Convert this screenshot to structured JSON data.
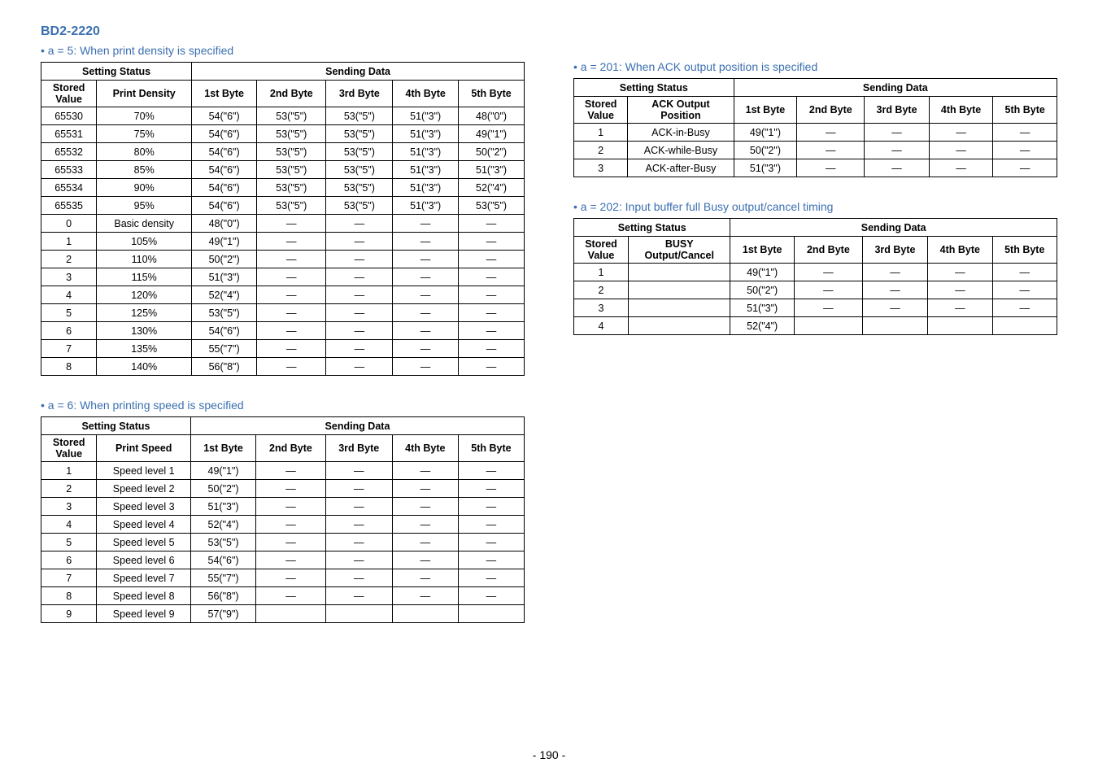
{
  "model": "BD2-2220",
  "page_number": "- 190 -",
  "tables": {
    "t5": {
      "title": "• a = 5: When print density is specified",
      "header_group1": "Setting Status",
      "header_group2": "Sending Data",
      "cols": [
        "Stored Value",
        "Print Density",
        "1st Byte",
        "2nd Byte",
        "3rd Byte",
        "4th Byte",
        "5th Byte"
      ],
      "rows": [
        [
          "65530",
          "70%",
          "54(\"6\")",
          "53(\"5\")",
          "53(\"5\")",
          "51(\"3\")",
          "48(\"0\")"
        ],
        [
          "65531",
          "75%",
          "54(\"6\")",
          "53(\"5\")",
          "53(\"5\")",
          "51(\"3\")",
          "49(\"1\")"
        ],
        [
          "65532",
          "80%",
          "54(\"6\")",
          "53(\"5\")",
          "53(\"5\")",
          "51(\"3\")",
          "50(\"2\")"
        ],
        [
          "65533",
          "85%",
          "54(\"6\")",
          "53(\"5\")",
          "53(\"5\")",
          "51(\"3\")",
          "51(\"3\")"
        ],
        [
          "65534",
          "90%",
          "54(\"6\")",
          "53(\"5\")",
          "53(\"5\")",
          "51(\"3\")",
          "52(\"4\")"
        ],
        [
          "65535",
          "95%",
          "54(\"6\")",
          "53(\"5\")",
          "53(\"5\")",
          "51(\"3\")",
          "53(\"5\")"
        ],
        [
          "0",
          "Basic density",
          "48(\"0\")",
          "―",
          "―",
          "―",
          "―"
        ],
        [
          "1",
          "105%",
          "49(\"1\")",
          "―",
          "―",
          "―",
          "―"
        ],
        [
          "2",
          "110%",
          "50(\"2\")",
          "―",
          "―",
          "―",
          "―"
        ],
        [
          "3",
          "115%",
          "51(\"3\")",
          "―",
          "―",
          "―",
          "―"
        ],
        [
          "4",
          "120%",
          "52(\"4\")",
          "―",
          "―",
          "―",
          "―"
        ],
        [
          "5",
          "125%",
          "53(\"5\")",
          "―",
          "―",
          "―",
          "―"
        ],
        [
          "6",
          "130%",
          "54(\"6\")",
          "―",
          "―",
          "―",
          "―"
        ],
        [
          "7",
          "135%",
          "55(\"7\")",
          "―",
          "―",
          "―",
          "―"
        ],
        [
          "8",
          "140%",
          "56(\"8\")",
          "―",
          "―",
          "―",
          "―"
        ]
      ]
    },
    "t6": {
      "title": "• a = 6: When printing speed is specified",
      "header_group1": "Setting Status",
      "header_group2": "Sending Data",
      "cols": [
        "Stored Value",
        "Print Speed",
        "1st Byte",
        "2nd Byte",
        "3rd Byte",
        "4th Byte",
        "5th Byte"
      ],
      "rows": [
        [
          "1",
          "Speed level 1",
          "49(\"1\")",
          "―",
          "―",
          "―",
          "―"
        ],
        [
          "2",
          "Speed level 2",
          "50(\"2\")",
          "―",
          "―",
          "―",
          "―"
        ],
        [
          "3",
          "Speed level 3",
          "51(\"3\")",
          "―",
          "―",
          "―",
          "―"
        ],
        [
          "4",
          "Speed level 4",
          "52(\"4\")",
          "―",
          "―",
          "―",
          "―"
        ],
        [
          "5",
          "Speed level 5",
          "53(\"5\")",
          "―",
          "―",
          "―",
          "―"
        ],
        [
          "6",
          "Speed level 6",
          "54(\"6\")",
          "―",
          "―",
          "―",
          "―"
        ],
        [
          "7",
          "Speed level 7",
          "55(\"7\")",
          "―",
          "―",
          "―",
          "―"
        ],
        [
          "8",
          "Speed level 8",
          "56(\"8\")",
          "―",
          "―",
          "―",
          "―"
        ],
        [
          "9",
          "Speed level 9",
          "57(\"9\")",
          "",
          "",
          "",
          ""
        ]
      ]
    },
    "t201": {
      "title": "• a = 201: When ACK output position is specified",
      "header_group1": "Setting Status",
      "header_group2": "Sending Data",
      "cols": [
        "Stored Value",
        "ACK Output Position",
        "1st Byte",
        "2nd Byte",
        "3rd Byte",
        "4th Byte",
        "5th Byte"
      ],
      "rows": [
        [
          "1",
          "ACK-in-Busy",
          "49(\"1\")",
          "―",
          "―",
          "―",
          "―"
        ],
        [
          "2",
          "ACK-while-Busy",
          "50(\"2\")",
          "―",
          "―",
          "―",
          "―"
        ],
        [
          "3",
          "ACK-after-Busy",
          "51(\"3\")",
          "―",
          "―",
          "―",
          "―"
        ]
      ]
    },
    "t202": {
      "title": "• a = 202: Input buffer full Busy output/cancel timing",
      "header_group1": "Setting Status",
      "header_group2": "Sending Data",
      "cols": [
        "Stored Value",
        "BUSY Output/Cancel",
        "1st Byte",
        "2nd Byte",
        "3rd Byte",
        "4th Byte",
        "5th Byte"
      ],
      "rows": [
        [
          "1",
          "",
          "49(\"1\")",
          "―",
          "―",
          "―",
          "―"
        ],
        [
          "2",
          "",
          "50(\"2\")",
          "―",
          "―",
          "―",
          "―"
        ],
        [
          "3",
          "",
          "51(\"3\")",
          "―",
          "―",
          "―",
          "―"
        ],
        [
          "4",
          "",
          "52(\"4\")",
          "",
          "",
          "",
          ""
        ]
      ]
    }
  }
}
